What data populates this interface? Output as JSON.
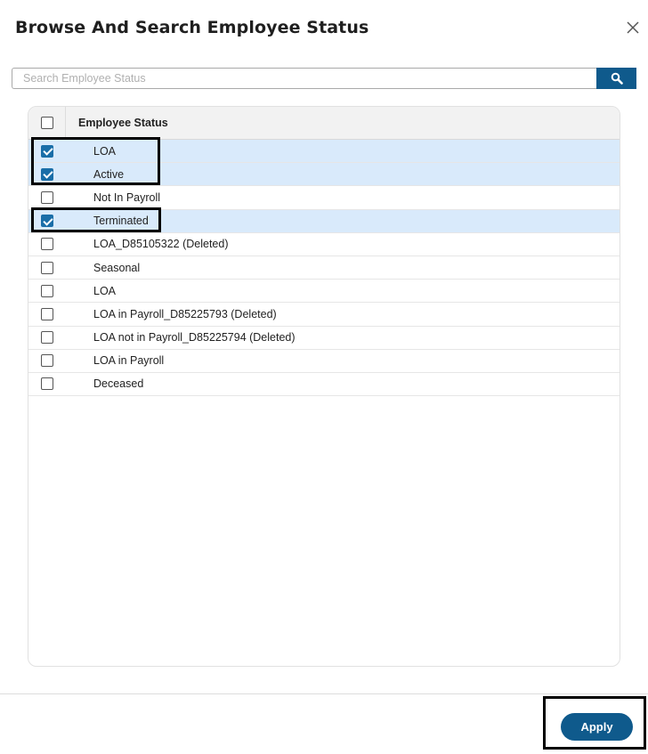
{
  "dialog": {
    "title": "Browse And Search Employee Status",
    "close_label": "X"
  },
  "search": {
    "placeholder": "Search Employee Status",
    "value": "",
    "button_icon": "search-icon"
  },
  "grid": {
    "header": {
      "label": "Employee Status",
      "select_all_checked": false
    },
    "rows": [
      {
        "label": "LOA",
        "checked": true
      },
      {
        "label": "Active",
        "checked": true
      },
      {
        "label": "Not In Payroll",
        "checked": false
      },
      {
        "label": "Terminated",
        "checked": true
      },
      {
        "label": "LOA_D85105322 (Deleted)",
        "checked": false
      },
      {
        "label": "Seasonal",
        "checked": false
      },
      {
        "label": "LOA",
        "checked": false
      },
      {
        "label": "LOA in Payroll_D85225793 (Deleted)",
        "checked": false
      },
      {
        "label": "LOA not in Payroll_D85225794 (Deleted)",
        "checked": false
      },
      {
        "label": "LOA in Payroll",
        "checked": false
      },
      {
        "label": "Deceased",
        "checked": false
      }
    ]
  },
  "footer": {
    "apply_label": "Apply"
  },
  "colors": {
    "primary": "#0f5a8c",
    "checkbox_checked": "#1a6ea8",
    "row_selected": "#d9eafb",
    "header_bg": "#f2f2f2"
  }
}
